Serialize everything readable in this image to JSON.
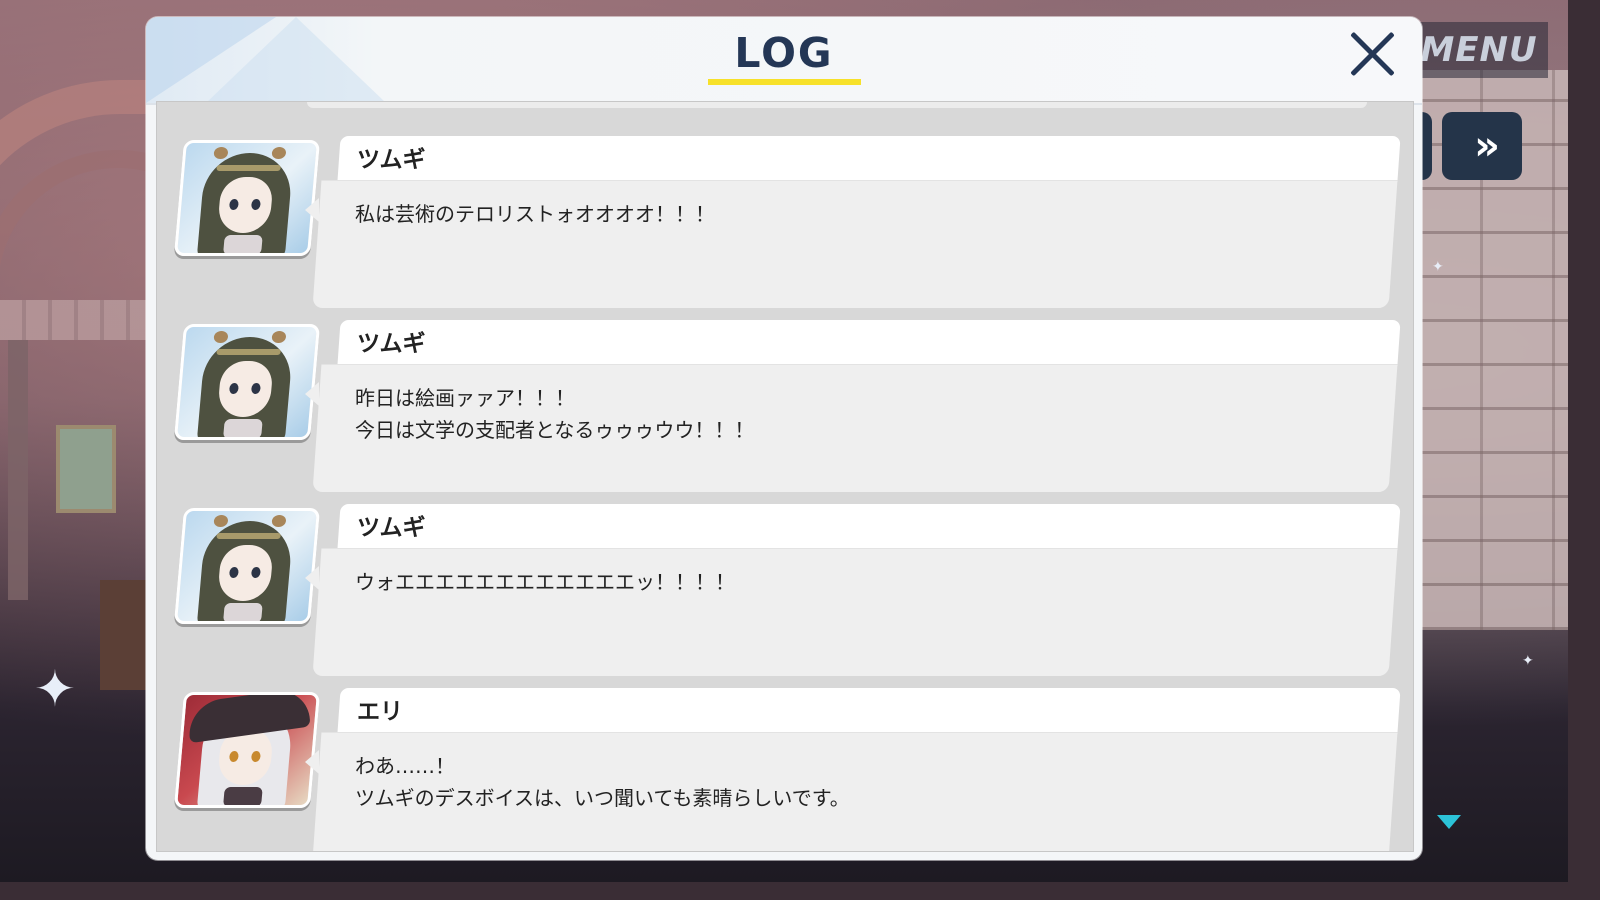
{
  "menu_label": "MENU",
  "fast_forward_glyph": "»",
  "log": {
    "title": "LOG",
    "accent_color": "#f7e12a",
    "entries": [
      {
        "speaker": "ツムギ",
        "lines": [
          "私は芸術のテロリストォオオオオ！！！"
        ]
      },
      {
        "speaker": "ツムギ",
        "lines": [
          "昨日は絵画ァァア！！！",
          "今日は文学の支配者となるゥゥゥウウ！！！"
        ]
      },
      {
        "speaker": "ツムギ",
        "lines": [
          "ウォエエエエエエエエエエエエッ！！！！"
        ]
      },
      {
        "speaker": "エリ",
        "lines": [
          "わあ……！",
          "ツムギのデスボイスは、いつ聞いても素晴らしいです。"
        ]
      }
    ]
  }
}
